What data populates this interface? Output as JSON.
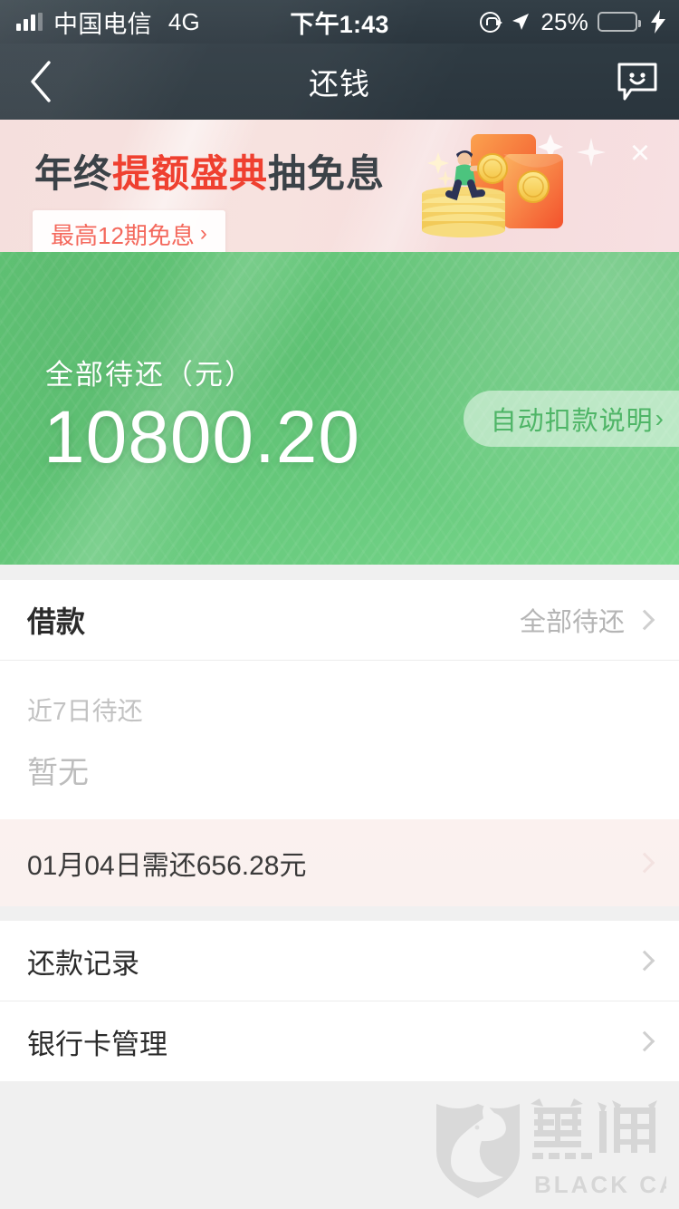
{
  "status_bar": {
    "carrier": "中国电信",
    "network": "4G",
    "time": "下午1:43",
    "battery_percent": "25%",
    "battery_level": 25,
    "icons": [
      "signal-bars-icon",
      "rotation-lock-icon",
      "location-arrow-icon",
      "battery-icon",
      "charging-bolt-icon"
    ]
  },
  "nav": {
    "back_icon": "chevron-left-icon",
    "title": "还钱",
    "service_icon": "chat-smiley-icon"
  },
  "banner": {
    "title_part1": "年终",
    "title_highlight": "提额盛典",
    "title_part2": "抽免息",
    "pill_label": "最高12期免息",
    "pill_chevron": "›",
    "close_label": "×",
    "highlight_color": "#ef4030",
    "background_color": "#f6e0de"
  },
  "balance_card": {
    "label": "全部待还（元）",
    "amount": "10800.20",
    "auto_deduct_label": "自动扣款说明",
    "auto_deduct_chevron": "›",
    "accent_color": "#5ec173"
  },
  "loan_section": {
    "title": "借款",
    "right_label": "全部待还",
    "sub_label": "近7日待还",
    "empty_text": "暂无"
  },
  "due_row": {
    "text": "01月04日需还656.28元",
    "background_color": "#faf1ef"
  },
  "menu": {
    "items": [
      {
        "label": "还款记录"
      },
      {
        "label": "银行卡管理"
      }
    ]
  },
  "watermark": {
    "cn_text": "黑猫",
    "en_text": "BLACK CAT"
  }
}
